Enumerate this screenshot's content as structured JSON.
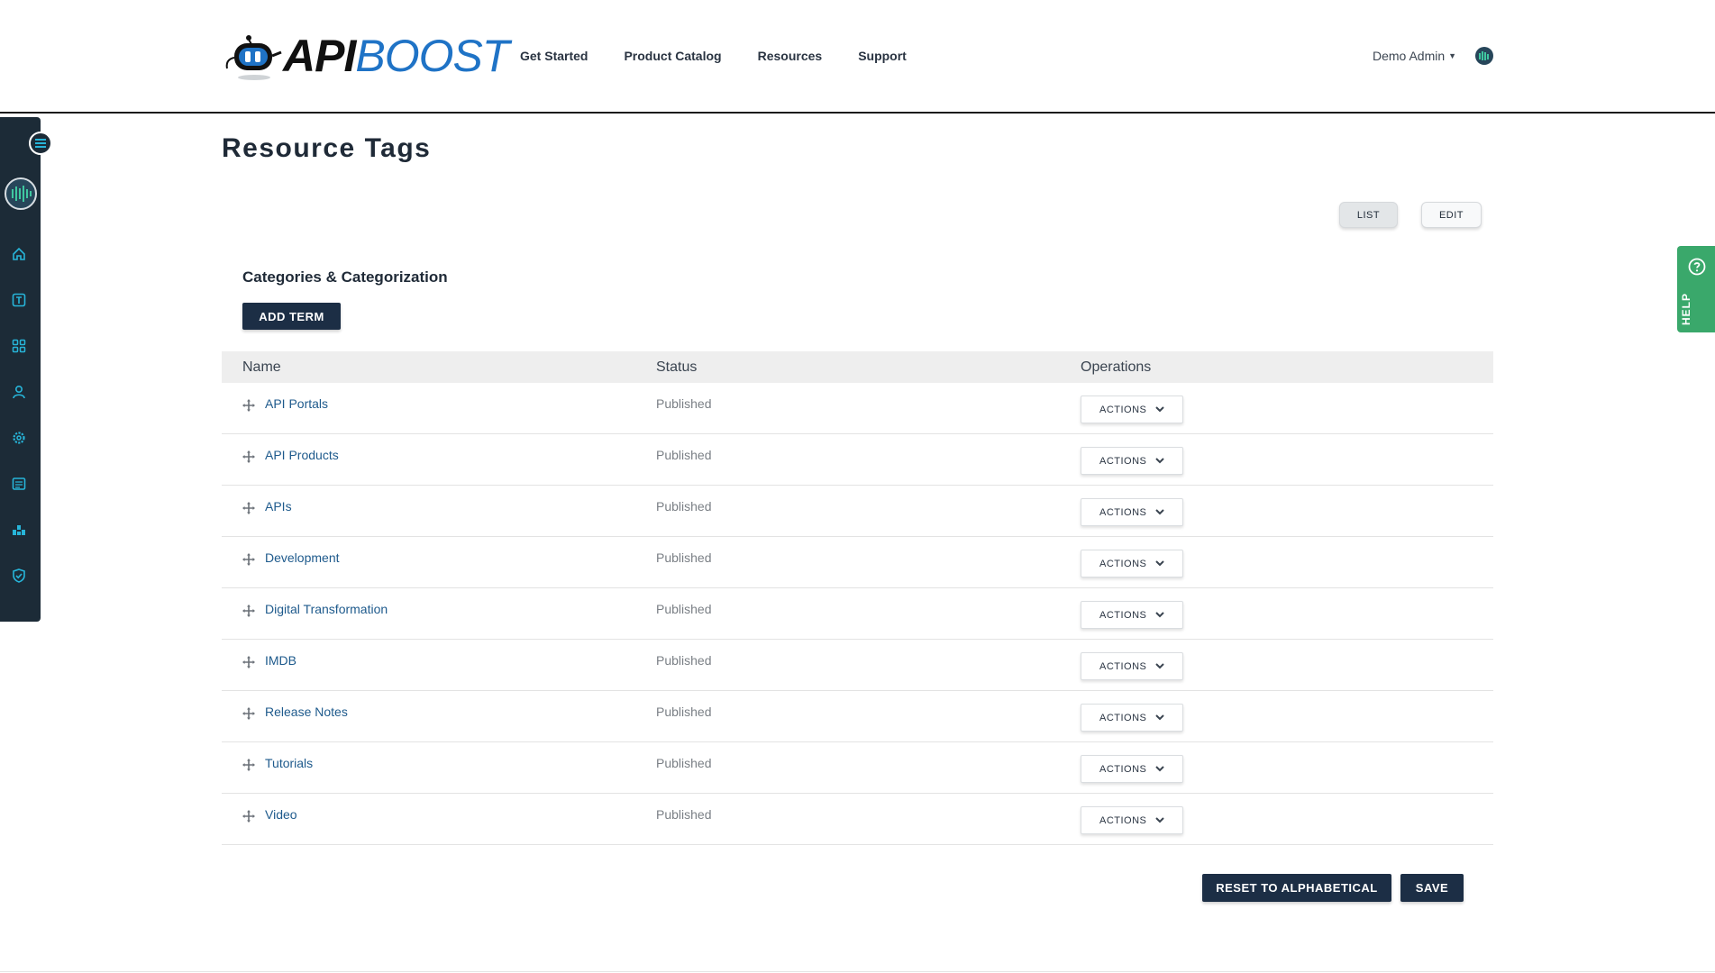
{
  "header": {
    "brand_api": "API",
    "brand_boost": "BOOST",
    "nav": [
      "Get Started",
      "Product Catalog",
      "Resources",
      "Support"
    ],
    "user_name": "Demo Admin"
  },
  "page": {
    "title": "Resource Tags",
    "tabs": {
      "list": "LIST",
      "edit": "EDIT"
    },
    "section_title": "Categories & Categorization",
    "add_term_label": "ADD TERM"
  },
  "table": {
    "columns": {
      "name": "Name",
      "status": "Status",
      "operations": "Operations"
    },
    "action_label": "ACTIONS",
    "rows": [
      {
        "name": "API Portals",
        "status": "Published"
      },
      {
        "name": "API Products",
        "status": "Published"
      },
      {
        "name": "APIs",
        "status": "Published"
      },
      {
        "name": "Development",
        "status": "Published"
      },
      {
        "name": "Digital Transformation",
        "status": "Published"
      },
      {
        "name": "IMDB",
        "status": "Published"
      },
      {
        "name": "Release Notes",
        "status": "Published"
      },
      {
        "name": "Tutorials",
        "status": "Published"
      },
      {
        "name": "Video",
        "status": "Published"
      }
    ]
  },
  "footer_actions": {
    "reset_label": "RESET TO ALPHABETICAL",
    "save_label": "SAVE"
  },
  "help": {
    "label": "HELP"
  },
  "sidebar": {
    "icons": [
      "home-icon",
      "text-icon",
      "grid-icon",
      "user-icon",
      "settings-icon",
      "content-icon",
      "blocks-icon",
      "shield-icon"
    ]
  },
  "colors": {
    "brand_blue": "#1f73c6",
    "primary_dark": "#1c2e45",
    "sidebar_bg": "#1c2b37",
    "sidebar_icon": "#27b5d9",
    "help_green": "#3aa86b",
    "link": "#1e5a8c"
  }
}
